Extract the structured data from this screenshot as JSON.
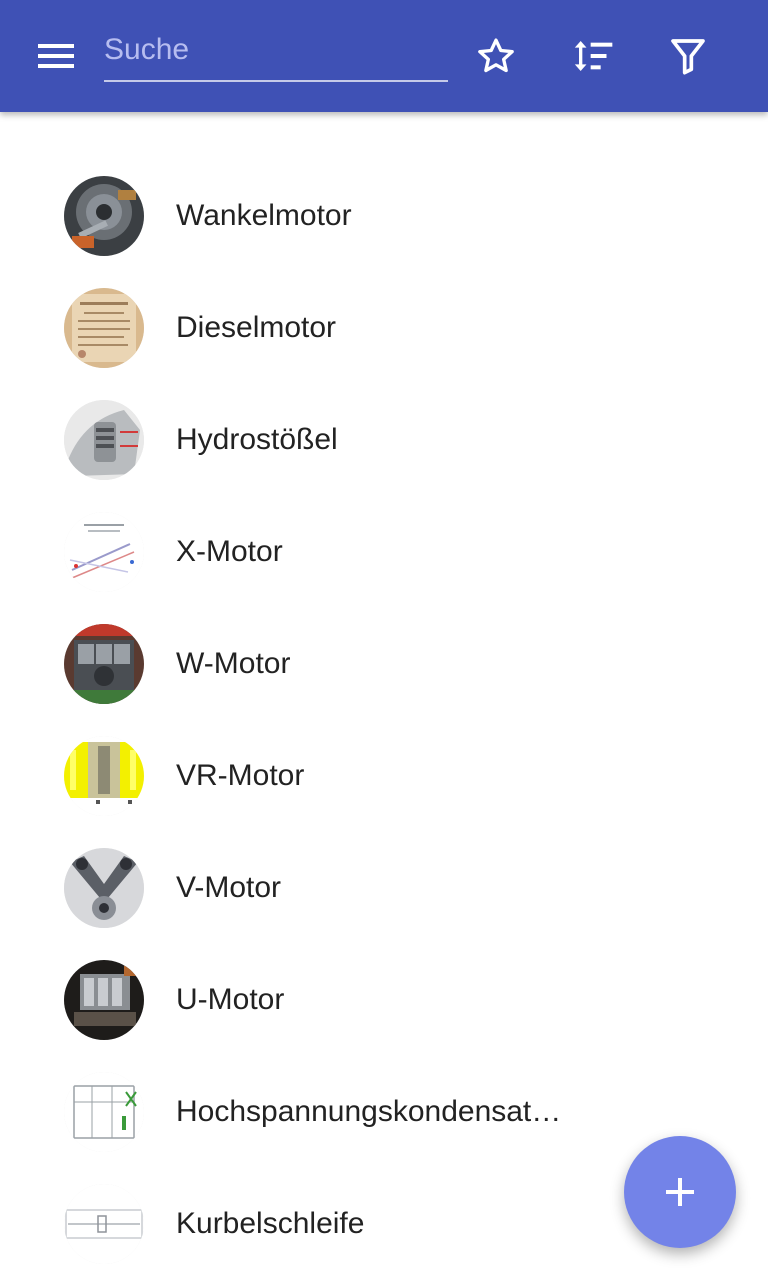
{
  "toolbar": {
    "menu_icon": "hamburger-menu-icon",
    "search_placeholder": "Suche",
    "search_value": "",
    "favorite_icon": "star-outline-icon",
    "sort_icon": "sort-icon",
    "filter_icon": "filter-icon"
  },
  "colors": {
    "appbar": "#3f51b5",
    "fab": "#7383e8",
    "text": "#222222"
  },
  "items": [
    {
      "label": "Wankelmotor"
    },
    {
      "label": "Dieselmotor"
    },
    {
      "label": "Hydrostößel"
    },
    {
      "label": "X-Motor"
    },
    {
      "label": "W-Motor"
    },
    {
      "label": "VR-Motor"
    },
    {
      "label": "V-Motor"
    },
    {
      "label": "U-Motor"
    },
    {
      "label": "Hochspannungskondensat…"
    },
    {
      "label": "Kurbelschleife"
    }
  ],
  "fab": {
    "icon": "plus-icon"
  }
}
